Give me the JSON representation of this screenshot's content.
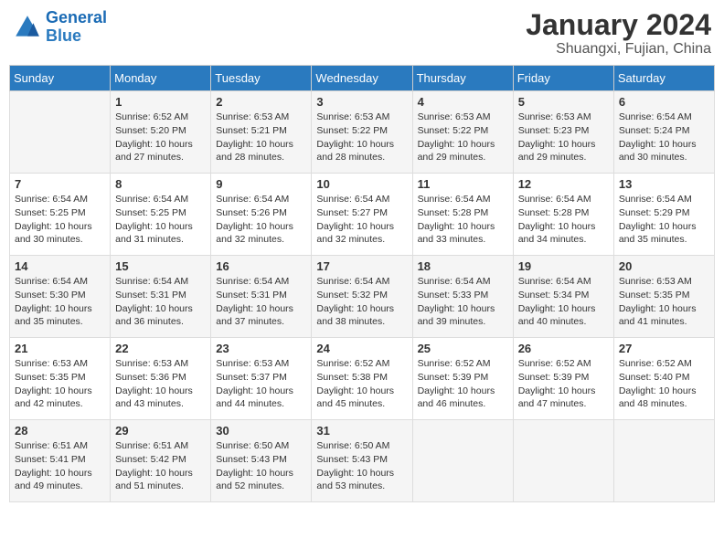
{
  "logo": {
    "text_general": "General",
    "text_blue": "Blue"
  },
  "title": "January 2024",
  "subtitle": "Shuangxi, Fujian, China",
  "days_of_week": [
    "Sunday",
    "Monday",
    "Tuesday",
    "Wednesday",
    "Thursday",
    "Friday",
    "Saturday"
  ],
  "weeks": [
    [
      {
        "num": "",
        "sunrise": "",
        "sunset": "",
        "daylight": ""
      },
      {
        "num": "1",
        "sunrise": "Sunrise: 6:52 AM",
        "sunset": "Sunset: 5:20 PM",
        "daylight": "Daylight: 10 hours and 27 minutes."
      },
      {
        "num": "2",
        "sunrise": "Sunrise: 6:53 AM",
        "sunset": "Sunset: 5:21 PM",
        "daylight": "Daylight: 10 hours and 28 minutes."
      },
      {
        "num": "3",
        "sunrise": "Sunrise: 6:53 AM",
        "sunset": "Sunset: 5:22 PM",
        "daylight": "Daylight: 10 hours and 28 minutes."
      },
      {
        "num": "4",
        "sunrise": "Sunrise: 6:53 AM",
        "sunset": "Sunset: 5:22 PM",
        "daylight": "Daylight: 10 hours and 29 minutes."
      },
      {
        "num": "5",
        "sunrise": "Sunrise: 6:53 AM",
        "sunset": "Sunset: 5:23 PM",
        "daylight": "Daylight: 10 hours and 29 minutes."
      },
      {
        "num": "6",
        "sunrise": "Sunrise: 6:54 AM",
        "sunset": "Sunset: 5:24 PM",
        "daylight": "Daylight: 10 hours and 30 minutes."
      }
    ],
    [
      {
        "num": "7",
        "sunrise": "Sunrise: 6:54 AM",
        "sunset": "Sunset: 5:25 PM",
        "daylight": "Daylight: 10 hours and 30 minutes."
      },
      {
        "num": "8",
        "sunrise": "Sunrise: 6:54 AM",
        "sunset": "Sunset: 5:25 PM",
        "daylight": "Daylight: 10 hours and 31 minutes."
      },
      {
        "num": "9",
        "sunrise": "Sunrise: 6:54 AM",
        "sunset": "Sunset: 5:26 PM",
        "daylight": "Daylight: 10 hours and 32 minutes."
      },
      {
        "num": "10",
        "sunrise": "Sunrise: 6:54 AM",
        "sunset": "Sunset: 5:27 PM",
        "daylight": "Daylight: 10 hours and 32 minutes."
      },
      {
        "num": "11",
        "sunrise": "Sunrise: 6:54 AM",
        "sunset": "Sunset: 5:28 PM",
        "daylight": "Daylight: 10 hours and 33 minutes."
      },
      {
        "num": "12",
        "sunrise": "Sunrise: 6:54 AM",
        "sunset": "Sunset: 5:28 PM",
        "daylight": "Daylight: 10 hours and 34 minutes."
      },
      {
        "num": "13",
        "sunrise": "Sunrise: 6:54 AM",
        "sunset": "Sunset: 5:29 PM",
        "daylight": "Daylight: 10 hours and 35 minutes."
      }
    ],
    [
      {
        "num": "14",
        "sunrise": "Sunrise: 6:54 AM",
        "sunset": "Sunset: 5:30 PM",
        "daylight": "Daylight: 10 hours and 35 minutes."
      },
      {
        "num": "15",
        "sunrise": "Sunrise: 6:54 AM",
        "sunset": "Sunset: 5:31 PM",
        "daylight": "Daylight: 10 hours and 36 minutes."
      },
      {
        "num": "16",
        "sunrise": "Sunrise: 6:54 AM",
        "sunset": "Sunset: 5:31 PM",
        "daylight": "Daylight: 10 hours and 37 minutes."
      },
      {
        "num": "17",
        "sunrise": "Sunrise: 6:54 AM",
        "sunset": "Sunset: 5:32 PM",
        "daylight": "Daylight: 10 hours and 38 minutes."
      },
      {
        "num": "18",
        "sunrise": "Sunrise: 6:54 AM",
        "sunset": "Sunset: 5:33 PM",
        "daylight": "Daylight: 10 hours and 39 minutes."
      },
      {
        "num": "19",
        "sunrise": "Sunrise: 6:54 AM",
        "sunset": "Sunset: 5:34 PM",
        "daylight": "Daylight: 10 hours and 40 minutes."
      },
      {
        "num": "20",
        "sunrise": "Sunrise: 6:53 AM",
        "sunset": "Sunset: 5:35 PM",
        "daylight": "Daylight: 10 hours and 41 minutes."
      }
    ],
    [
      {
        "num": "21",
        "sunrise": "Sunrise: 6:53 AM",
        "sunset": "Sunset: 5:35 PM",
        "daylight": "Daylight: 10 hours and 42 minutes."
      },
      {
        "num": "22",
        "sunrise": "Sunrise: 6:53 AM",
        "sunset": "Sunset: 5:36 PM",
        "daylight": "Daylight: 10 hours and 43 minutes."
      },
      {
        "num": "23",
        "sunrise": "Sunrise: 6:53 AM",
        "sunset": "Sunset: 5:37 PM",
        "daylight": "Daylight: 10 hours and 44 minutes."
      },
      {
        "num": "24",
        "sunrise": "Sunrise: 6:52 AM",
        "sunset": "Sunset: 5:38 PM",
        "daylight": "Daylight: 10 hours and 45 minutes."
      },
      {
        "num": "25",
        "sunrise": "Sunrise: 6:52 AM",
        "sunset": "Sunset: 5:39 PM",
        "daylight": "Daylight: 10 hours and 46 minutes."
      },
      {
        "num": "26",
        "sunrise": "Sunrise: 6:52 AM",
        "sunset": "Sunset: 5:39 PM",
        "daylight": "Daylight: 10 hours and 47 minutes."
      },
      {
        "num": "27",
        "sunrise": "Sunrise: 6:52 AM",
        "sunset": "Sunset: 5:40 PM",
        "daylight": "Daylight: 10 hours and 48 minutes."
      }
    ],
    [
      {
        "num": "28",
        "sunrise": "Sunrise: 6:51 AM",
        "sunset": "Sunset: 5:41 PM",
        "daylight": "Daylight: 10 hours and 49 minutes."
      },
      {
        "num": "29",
        "sunrise": "Sunrise: 6:51 AM",
        "sunset": "Sunset: 5:42 PM",
        "daylight": "Daylight: 10 hours and 51 minutes."
      },
      {
        "num": "30",
        "sunrise": "Sunrise: 6:50 AM",
        "sunset": "Sunset: 5:43 PM",
        "daylight": "Daylight: 10 hours and 52 minutes."
      },
      {
        "num": "31",
        "sunrise": "Sunrise: 6:50 AM",
        "sunset": "Sunset: 5:43 PM",
        "daylight": "Daylight: 10 hours and 53 minutes."
      },
      {
        "num": "",
        "sunrise": "",
        "sunset": "",
        "daylight": ""
      },
      {
        "num": "",
        "sunrise": "",
        "sunset": "",
        "daylight": ""
      },
      {
        "num": "",
        "sunrise": "",
        "sunset": "",
        "daylight": ""
      }
    ]
  ]
}
